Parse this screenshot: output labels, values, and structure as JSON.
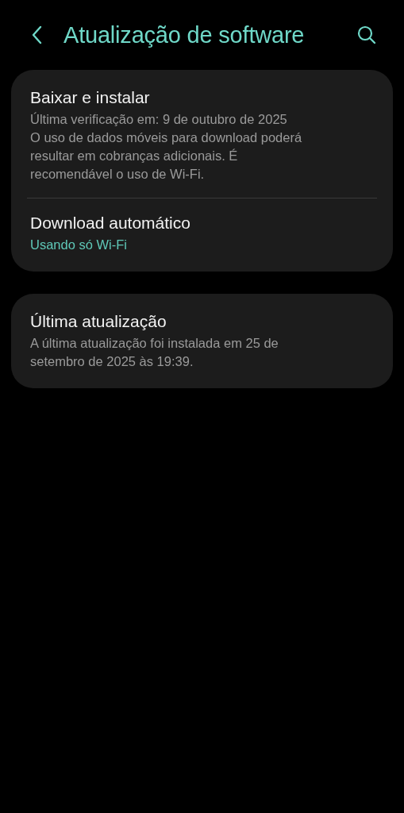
{
  "header": {
    "title": "Atualização de software"
  },
  "cards": [
    {
      "items": [
        {
          "title": "Baixar e instalar",
          "lines": [
            {
              "kind": "note",
              "text": "Última verificação em: 9 de outubro de 2025"
            },
            {
              "kind": "note",
              "text": "O uso de dados móveis para download poderá resultar em cobranças adicionais. É recomendável o uso de Wi-Fi."
            }
          ]
        },
        {
          "title": "Download automático",
          "lines": [
            {
              "kind": "accent",
              "text": "Usando só Wi-Fi"
            }
          ]
        }
      ]
    },
    {
      "items": [
        {
          "title": "Última atualização",
          "lines": [
            {
              "kind": "note",
              "text": "A última atualização foi instalada em 25 de setembro de 2025 às 19:39."
            }
          ]
        }
      ]
    }
  ]
}
